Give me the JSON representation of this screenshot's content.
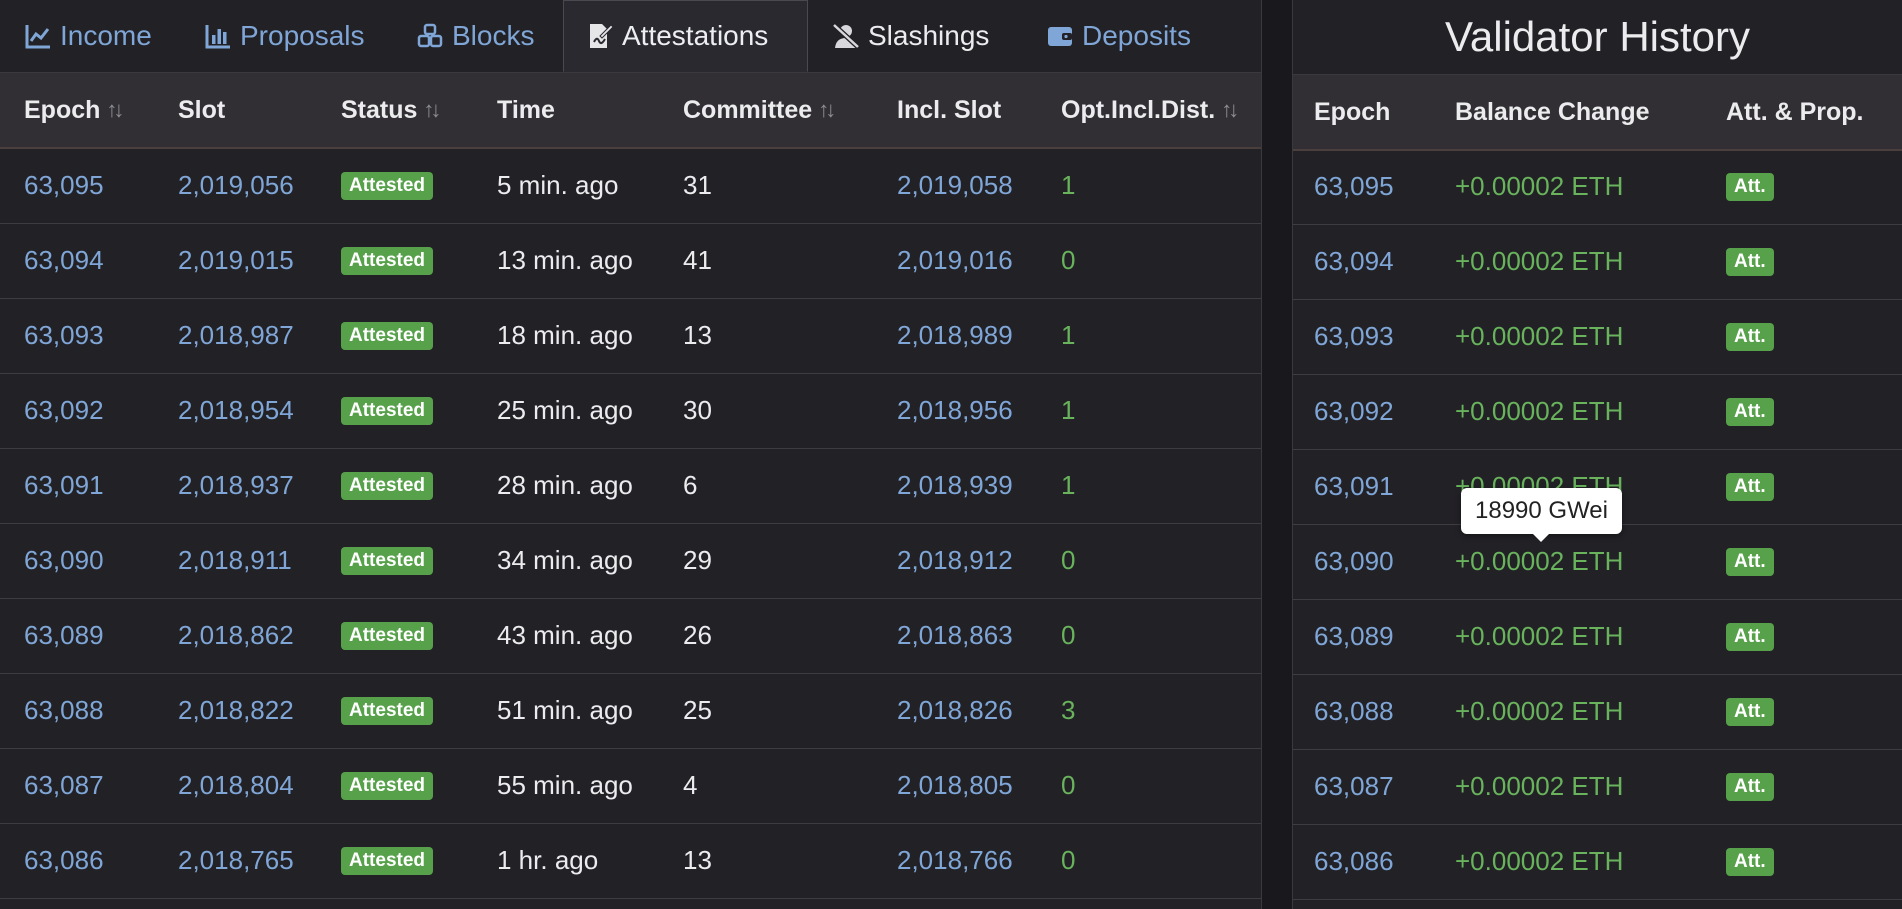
{
  "tabs": [
    {
      "label": "Income",
      "icon": "chart-line-icon",
      "active": false
    },
    {
      "label": "Proposals",
      "icon": "bar-chart-icon",
      "active": false
    },
    {
      "label": "Blocks",
      "icon": "cubes-icon",
      "active": false
    },
    {
      "label": "Attestations",
      "icon": "file-signature-icon",
      "active": true
    },
    {
      "label": "Slashings",
      "icon": "user-slash-icon",
      "active": false
    },
    {
      "label": "Deposits",
      "icon": "wallet-icon",
      "active": false
    }
  ],
  "attestations": {
    "headers": [
      "Epoch",
      "Slot",
      "Status",
      "Time",
      "Committee",
      "Incl. Slot",
      "Opt.Incl.Dist."
    ],
    "sort_icon": "sort-icon",
    "rows": [
      {
        "epoch": "63,095",
        "slot": "2,019,056",
        "status": "Attested",
        "time": "5 min. ago",
        "committee": "31",
        "incl_slot": "2,019,058",
        "dist": "1"
      },
      {
        "epoch": "63,094",
        "slot": "2,019,015",
        "status": "Attested",
        "time": "13 min. ago",
        "committee": "41",
        "incl_slot": "2,019,016",
        "dist": "0"
      },
      {
        "epoch": "63,093",
        "slot": "2,018,987",
        "status": "Attested",
        "time": "18 min. ago",
        "committee": "13",
        "incl_slot": "2,018,989",
        "dist": "1"
      },
      {
        "epoch": "63,092",
        "slot": "2,018,954",
        "status": "Attested",
        "time": "25 min. ago",
        "committee": "30",
        "incl_slot": "2,018,956",
        "dist": "1"
      },
      {
        "epoch": "63,091",
        "slot": "2,018,937",
        "status": "Attested",
        "time": "28 min. ago",
        "committee": "6",
        "incl_slot": "2,018,939",
        "dist": "1"
      },
      {
        "epoch": "63,090",
        "slot": "2,018,911",
        "status": "Attested",
        "time": "34 min. ago",
        "committee": "29",
        "incl_slot": "2,018,912",
        "dist": "0"
      },
      {
        "epoch": "63,089",
        "slot": "2,018,862",
        "status": "Attested",
        "time": "43 min. ago",
        "committee": "26",
        "incl_slot": "2,018,863",
        "dist": "0"
      },
      {
        "epoch": "63,088",
        "slot": "2,018,822",
        "status": "Attested",
        "time": "51 min. ago",
        "committee": "25",
        "incl_slot": "2,018,826",
        "dist": "3"
      },
      {
        "epoch": "63,087",
        "slot": "2,018,804",
        "status": "Attested",
        "time": "55 min. ago",
        "committee": "4",
        "incl_slot": "2,018,805",
        "dist": "0"
      },
      {
        "epoch": "63,086",
        "slot": "2,018,765",
        "status": "Attested",
        "time": "1 hr. ago",
        "committee": "13",
        "incl_slot": "2,018,766",
        "dist": "0"
      }
    ]
  },
  "history": {
    "title": "Validator History",
    "headers": [
      "Epoch",
      "Balance Change",
      "Att. & Prop."
    ],
    "rows": [
      {
        "epoch": "63,095",
        "change": "+0.00002 ETH",
        "badge": "Att."
      },
      {
        "epoch": "63,094",
        "change": "+0.00002 ETH",
        "badge": "Att."
      },
      {
        "epoch": "63,093",
        "change": "+0.00002 ETH",
        "badge": "Att."
      },
      {
        "epoch": "63,092",
        "change": "+0.00002 ETH",
        "badge": "Att."
      },
      {
        "epoch": "63,091",
        "change": "+0.00002 ETH",
        "badge": "Att."
      },
      {
        "epoch": "63,090",
        "change": "+0.00002 ETH",
        "badge": "Att."
      },
      {
        "epoch": "63,089",
        "change": "+0.00002 ETH",
        "badge": "Att."
      },
      {
        "epoch": "63,088",
        "change": "+0.00002 ETH",
        "badge": "Att."
      },
      {
        "epoch": "63,087",
        "change": "+0.00002 ETH",
        "badge": "Att."
      },
      {
        "epoch": "63,086",
        "change": "+0.00002 ETH",
        "badge": "Att."
      }
    ]
  },
  "tooltip": {
    "text": "18990 GWei"
  },
  "colors": {
    "link": "#7fa6d6",
    "positive": "#68b35c",
    "badge": "#57a14b",
    "background": "#222126"
  }
}
